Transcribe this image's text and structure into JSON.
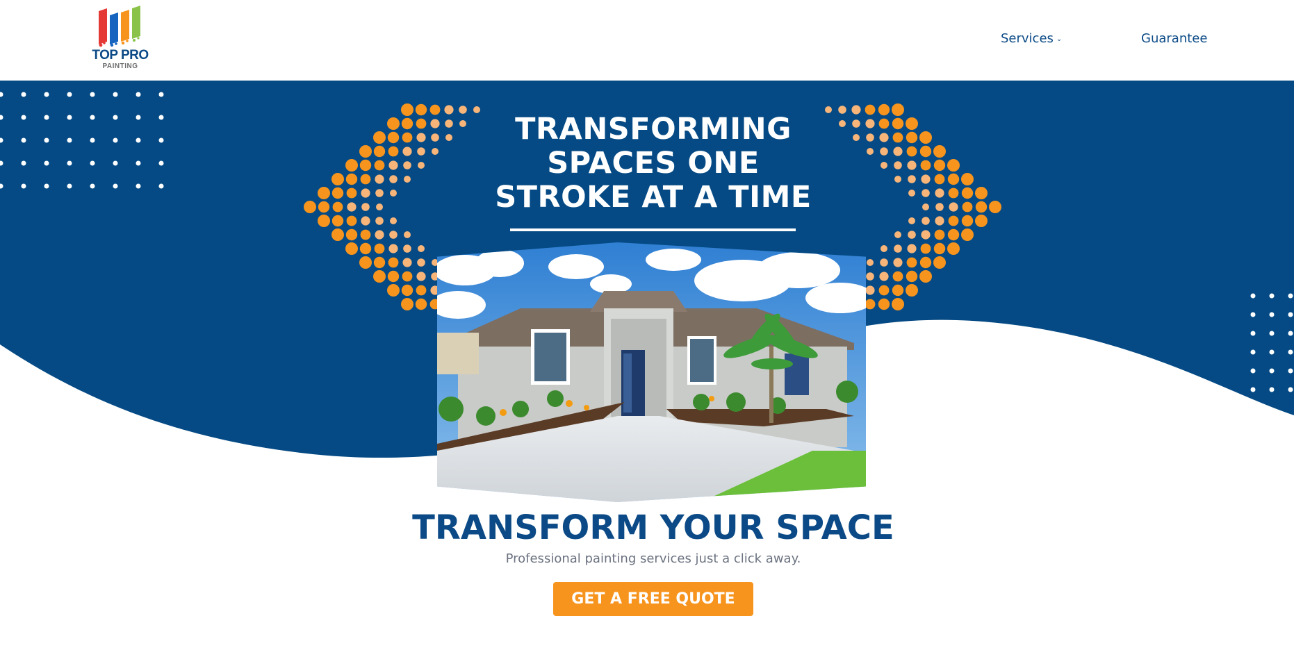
{
  "brand": {
    "name": "TOP PRO",
    "subtitle": "PAINTING",
    "logo_colors": [
      "#e53935",
      "#1565c0",
      "#f7941d",
      "#8bc34a"
    ]
  },
  "nav": {
    "items": [
      {
        "label": "Services",
        "has_dropdown": true,
        "icon": "chevron-down-icon"
      },
      {
        "label": "Guarantee",
        "has_dropdown": false
      }
    ]
  },
  "hero": {
    "title": "TRANSFORMING\nSPACES ONE\nSTROKE AT A TIME",
    "image_description": "photo of a single-story gray house with palm tree and landscaped walkway"
  },
  "main": {
    "heading": "TRANSFORM YOUR SPACE",
    "subheading": "Professional painting services just a click away.",
    "cta_label": "GET A FREE QUOTE"
  },
  "colors": {
    "primary_blue": "#0b4a86",
    "accent_orange": "#f7941d",
    "dot_light_orange": "#f7b57a",
    "text_gray": "#6b7280",
    "white": "#ffffff"
  }
}
